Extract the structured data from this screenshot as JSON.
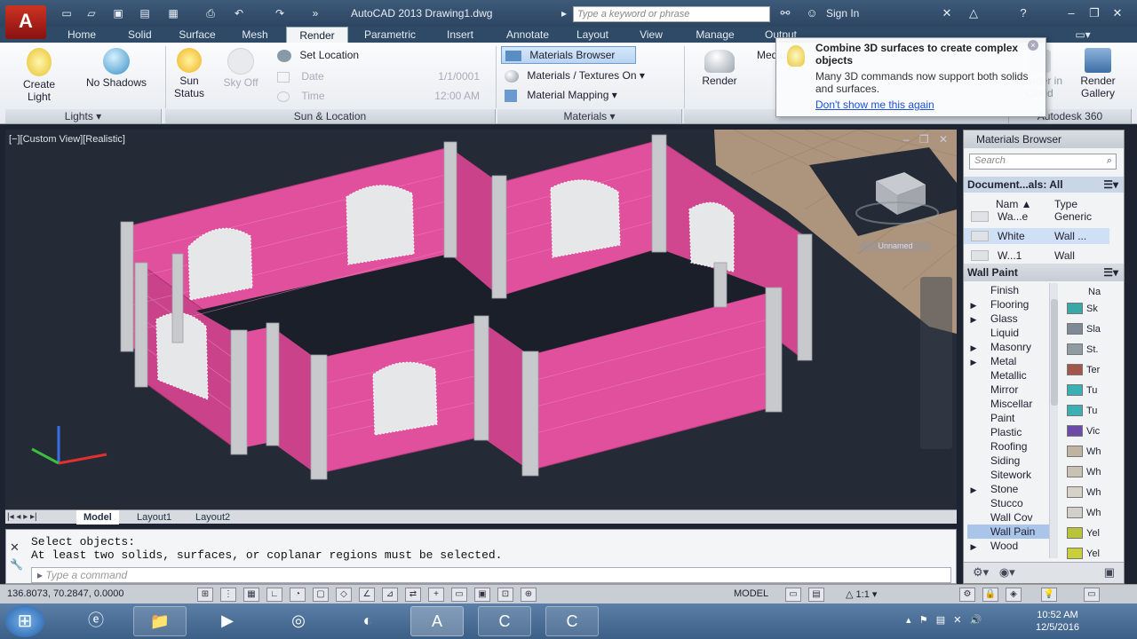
{
  "app": {
    "title": "AutoCAD 2013   Drawing1.dwg",
    "search_placeholder": "Type a keyword or phrase",
    "sign_in": "Sign In"
  },
  "tabs": [
    "Home",
    "Solid",
    "Surface",
    "Mesh",
    "Render",
    "Parametric",
    "Insert",
    "Annotate",
    "Layout",
    "View",
    "Manage",
    "Output"
  ],
  "active_tab": "Render",
  "ribbon": {
    "lights_panel": "Lights",
    "create_light": "Create\nLight",
    "no_shadows": "No Shadows",
    "sun_status": "Sun\nStatus",
    "sky_off": "Sky Off",
    "sun_location_panel": "Sun & Location",
    "set_location": "Set Location",
    "date_label": "Date",
    "date_value": "1/1/0001",
    "time_label": "Time",
    "time_value": "12:00 AM",
    "materials_panel": "Materials",
    "materials_browser": "Materials Browser",
    "materials_textures": "Materials / Textures On",
    "material_mapping": "Material Mapping",
    "render": "Render",
    "medium": "Medium",
    "render_in_cloud": "Render in\nCloud",
    "render_gallery": "Render\nGallery",
    "autodesk360": "Autodesk 360"
  },
  "tooltip": {
    "title": "Combine 3D surfaces to create complex objects",
    "body": "Many 3D commands now support both solids and surfaces.",
    "link": "Don't show me this again"
  },
  "viewport": {
    "label": "[−][Custom View][Realistic]",
    "unnamed": "Unnamed"
  },
  "layout_tabs": [
    "Model",
    "Layout1",
    "Layout2"
  ],
  "command": {
    "history": [
      "Select objects:",
      "At least two solids, surfaces, or coplanar regions must be selected."
    ],
    "placeholder": "Type a command"
  },
  "status": {
    "coords": "136.8073, 70.2847, 0.0000",
    "model": "MODEL",
    "scale": "1:1"
  },
  "materials_browser": {
    "title": "Materials Browser",
    "search_placeholder": "Search",
    "doc_header": "Document...als: All",
    "col_name": "Nam",
    "col_type": "Type",
    "rows": [
      {
        "name": "Wa...e",
        "type": "Generic"
      },
      {
        "name": "White",
        "type": "Wall ..."
      },
      {
        "name": "W...1",
        "type": "Wall"
      }
    ],
    "library_header": "Wall Paint",
    "categories": [
      "Finish",
      "Flooring",
      "Glass",
      "Liquid",
      "Masonry",
      "Metal",
      "Metallic",
      "Mirror",
      "Miscellar",
      "Paint",
      "Plastic",
      "Roofing",
      "Siding",
      "Sitework",
      "Stone",
      "Stucco",
      "Wall Cov",
      "Wall Pain",
      "Wood"
    ],
    "expandable": [
      "Flooring",
      "Glass",
      "Masonry",
      "Metal",
      "Stone",
      "Wood"
    ],
    "selected_category": "Wall Pain",
    "col_na": "Na",
    "swatch_labels": [
      "Sk",
      "Sla",
      "St.",
      "Ter",
      "Tu",
      "Tu",
      "Vic",
      "Wh",
      "Wh",
      "Wh",
      "Wh",
      "Yel",
      "Yel"
    ],
    "swatch_colors": [
      "#3aa7a8",
      "#7e8a95",
      "#8f9aa3",
      "#a2574a",
      "#3ab0b4",
      "#3ab0b4",
      "#6c4aa8",
      "#bfb3a2",
      "#c9c1b3",
      "#d7d2c8",
      "#d2cec8",
      "#b9c43a",
      "#c8cf3a"
    ]
  },
  "taskbar": {
    "time": "10:52 AM",
    "date": "12/5/2016"
  },
  "colors": {
    "wall": "#e0509c",
    "wall_dark": "#b83c7d",
    "column": "#c7c9cc",
    "window": "#e6e7e9",
    "floor": "#b59a82",
    "viewport_bg": "#242a36"
  }
}
